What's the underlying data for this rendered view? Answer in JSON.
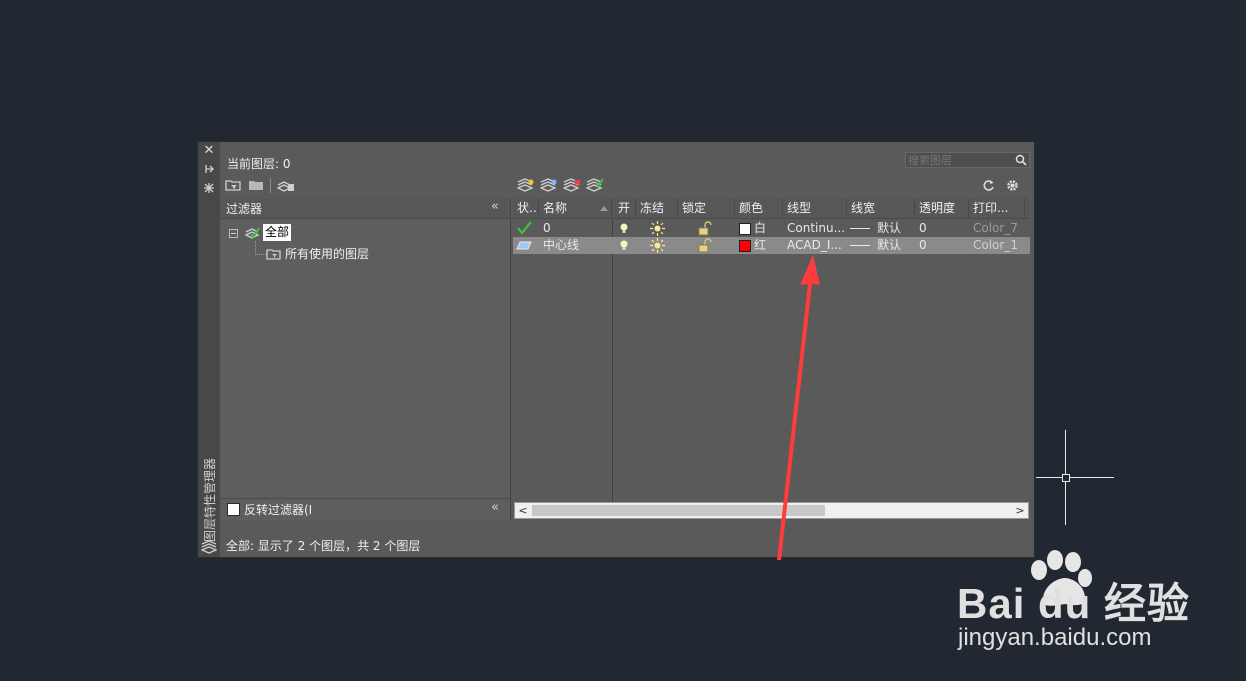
{
  "palette": {
    "title": "图层特性管理器",
    "current_layer_label": "当前图层: 0",
    "search_placeholder": "搜索图层"
  },
  "filters": {
    "header": "过滤器",
    "tree_root": "全部",
    "tree_child": "所有使用的图层",
    "invert_label": "反转过滤器(I"
  },
  "columns": [
    "状..",
    "名称",
    "开",
    "冻结",
    "锁定",
    "颜色",
    "线型",
    "线宽",
    "透明度",
    "打印..."
  ],
  "layers": [
    {
      "name": "0",
      "color_name": "白",
      "color_hex": "#ffffff",
      "linetype": "Continu...",
      "lineweight": "默认",
      "transparency": "0",
      "plot_style": "Color_7",
      "current": true,
      "selected": false
    },
    {
      "name": "中心线",
      "color_name": "红",
      "color_hex": "#ff0000",
      "linetype": "ACAD_I...",
      "lineweight": "默认",
      "transparency": "0",
      "plot_style": "Color_1",
      "current": false,
      "selected": true
    }
  ],
  "status": "全部: 显示了 2 个图层，共 2 个图层",
  "watermark": {
    "brand": "Bai du 经验",
    "url": "jingyan.baidu.com"
  },
  "colors": {
    "background": "#222831",
    "panel": "#5a5a5a",
    "selected_row": "#8a8a8a",
    "annotation_arrow": "#ff3b3b"
  }
}
